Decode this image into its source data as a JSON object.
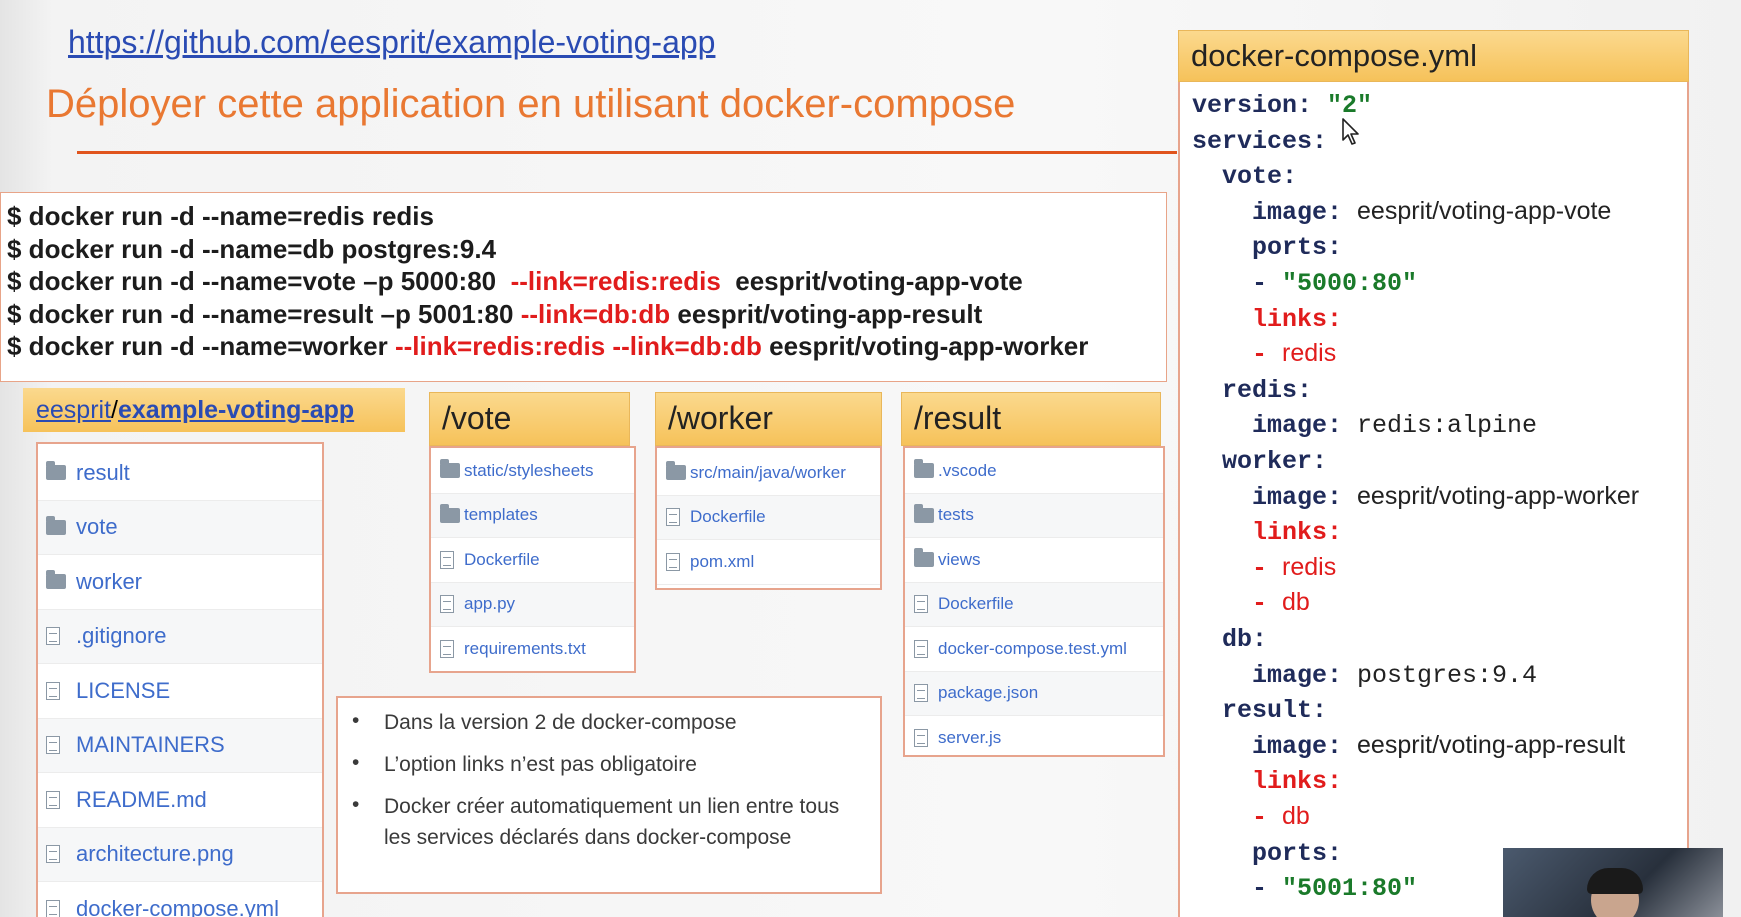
{
  "header": {
    "url": "https://github.com/eesprit/example-voting-app",
    "title": "Déployer cette application en utilisant docker-compose"
  },
  "commands": [
    {
      "parts": [
        {
          "t": "$ docker run -d --name=redis redis",
          "red": false
        }
      ]
    },
    {
      "parts": [
        {
          "t": "$ docker run -d --name=db postgres:9.4",
          "red": false
        }
      ]
    },
    {
      "parts": [
        {
          "t": "$ docker run -d --name=vote –p 5000:80  ",
          "red": false
        },
        {
          "t": "--link=redis:redis",
          "red": true
        },
        {
          "t": "  eesprit/voting-app-vote",
          "red": false
        }
      ]
    },
    {
      "parts": [
        {
          "t": "$ docker run -d --name=result –p 5001:80 ",
          "red": false
        },
        {
          "t": "--link=db:db",
          "red": true
        },
        {
          "t": " eesprit/voting-app-result",
          "red": false
        }
      ]
    },
    {
      "parts": [
        {
          "t": "$ docker run -d --name=worker ",
          "red": false
        },
        {
          "t": "--link=redis:redis --link=db:db",
          "red": true
        },
        {
          "t": " eesprit/voting-app-worker",
          "red": false
        }
      ]
    }
  ],
  "repo": {
    "owner": "eesprit",
    "separator": "/",
    "name": "example-voting-app",
    "items": [
      {
        "name": "result",
        "type": "folder"
      },
      {
        "name": "vote",
        "type": "folder"
      },
      {
        "name": "worker",
        "type": "folder"
      },
      {
        "name": ".gitignore",
        "type": "file"
      },
      {
        "name": "LICENSE",
        "type": "file"
      },
      {
        "name": "MAINTAINERS",
        "type": "file"
      },
      {
        "name": "README.md",
        "type": "file"
      },
      {
        "name": "architecture.png",
        "type": "file"
      },
      {
        "name": "docker-compose.yml",
        "type": "file"
      }
    ]
  },
  "vote": {
    "title": "/vote",
    "items": [
      {
        "name": "static/stylesheets",
        "type": "folder"
      },
      {
        "name": "templates",
        "type": "folder"
      },
      {
        "name": "Dockerfile",
        "type": "file"
      },
      {
        "name": "app.py",
        "type": "file"
      },
      {
        "name": "requirements.txt",
        "type": "file"
      }
    ]
  },
  "worker": {
    "title": "/worker",
    "items": [
      {
        "name": "src/main/java/worker",
        "type": "folder"
      },
      {
        "name": "Dockerfile",
        "type": "file"
      },
      {
        "name": "pom.xml",
        "type": "file"
      }
    ]
  },
  "result": {
    "title": "/result",
    "items": [
      {
        "name": ".vscode",
        "type": "folder"
      },
      {
        "name": "tests",
        "type": "folder"
      },
      {
        "name": "views",
        "type": "folder"
      },
      {
        "name": "Dockerfile",
        "type": "file"
      },
      {
        "name": "docker-compose.test.yml",
        "type": "file"
      },
      {
        "name": "package.json",
        "type": "file"
      },
      {
        "name": "server.js",
        "type": "file"
      }
    ]
  },
  "notes": {
    "bullet": "•",
    "items": [
      "Dans la version 2 de docker-compose",
      "L’option links n’est pas obligatoire",
      "Docker créer automatiquement un lien entre tous les services déclarés dans docker-compose"
    ]
  },
  "compose": {
    "filename": "docker-compose.yml",
    "lines": [
      {
        "indent": 0,
        "parts": [
          {
            "t": "version: ",
            "c": "k"
          },
          {
            "t": "\"2\"",
            "c": "g"
          }
        ]
      },
      {
        "indent": 0,
        "parts": [
          {
            "t": "services:",
            "c": "k"
          }
        ]
      },
      {
        "indent": 1,
        "parts": [
          {
            "t": "vote:",
            "c": "k"
          }
        ]
      },
      {
        "indent": 2,
        "parts": [
          {
            "t": "image: ",
            "c": "k"
          },
          {
            "t": "eesprit/voting-app-vote",
            "c": "v"
          }
        ]
      },
      {
        "indent": 2,
        "parts": [
          {
            "t": "ports:",
            "c": "k"
          }
        ]
      },
      {
        "indent": 2,
        "parts": [
          {
            "t": "- ",
            "c": "k"
          },
          {
            "t": "\"5000:80\"",
            "c": "g"
          }
        ]
      },
      {
        "indent": 2,
        "parts": [
          {
            "t": "links:",
            "c": "rk"
          }
        ]
      },
      {
        "indent": 2,
        "parts": [
          {
            "t": "- ",
            "c": "rk"
          },
          {
            "t": "redis",
            "c": "rv"
          }
        ]
      },
      {
        "indent": 1,
        "parts": [
          {
            "t": "redis:",
            "c": "k"
          }
        ]
      },
      {
        "indent": 2,
        "parts": [
          {
            "t": "image: ",
            "c": "k"
          },
          {
            "t": "redis:alpine",
            "c": "vm"
          }
        ]
      },
      {
        "indent": 1,
        "parts": [
          {
            "t": "worker:",
            "c": "k"
          }
        ]
      },
      {
        "indent": 2,
        "parts": [
          {
            "t": "image: ",
            "c": "k"
          },
          {
            "t": "eesprit/voting-app-worker",
            "c": "v"
          }
        ]
      },
      {
        "indent": 2,
        "parts": [
          {
            "t": "links:",
            "c": "rk"
          }
        ]
      },
      {
        "indent": 2,
        "parts": [
          {
            "t": "- ",
            "c": "rk"
          },
          {
            "t": "redis",
            "c": "rv"
          }
        ]
      },
      {
        "indent": 2,
        "parts": [
          {
            "t": "- ",
            "c": "rk"
          },
          {
            "t": "db",
            "c": "rv"
          }
        ]
      },
      {
        "indent": 1,
        "parts": [
          {
            "t": "db:",
            "c": "k"
          }
        ]
      },
      {
        "indent": 2,
        "parts": [
          {
            "t": "image: ",
            "c": "k"
          },
          {
            "t": "postgres:9.4",
            "c": "vm"
          }
        ]
      },
      {
        "indent": 1,
        "parts": [
          {
            "t": "result:",
            "c": "k"
          }
        ]
      },
      {
        "indent": 2,
        "parts": [
          {
            "t": "image: ",
            "c": "k"
          },
          {
            "t": "eesprit/voting-app-result",
            "c": "v"
          }
        ]
      },
      {
        "indent": 2,
        "parts": [
          {
            "t": "links:",
            "c": "rk"
          }
        ]
      },
      {
        "indent": 2,
        "parts": [
          {
            "t": "- ",
            "c": "rk"
          },
          {
            "t": "db",
            "c": "rv"
          }
        ]
      },
      {
        "indent": 2,
        "parts": [
          {
            "t": "ports:",
            "c": "k"
          }
        ]
      },
      {
        "indent": 2,
        "parts": [
          {
            "t": "- ",
            "c": "k"
          },
          {
            "t": "\"5001:80\"",
            "c": "g"
          }
        ]
      }
    ]
  },
  "colors": {
    "title": "#e97832",
    "link": "#2a4bb3",
    "red": "#e11c1c",
    "green": "#1a7a2a",
    "header_fill": "#f6c25a"
  }
}
